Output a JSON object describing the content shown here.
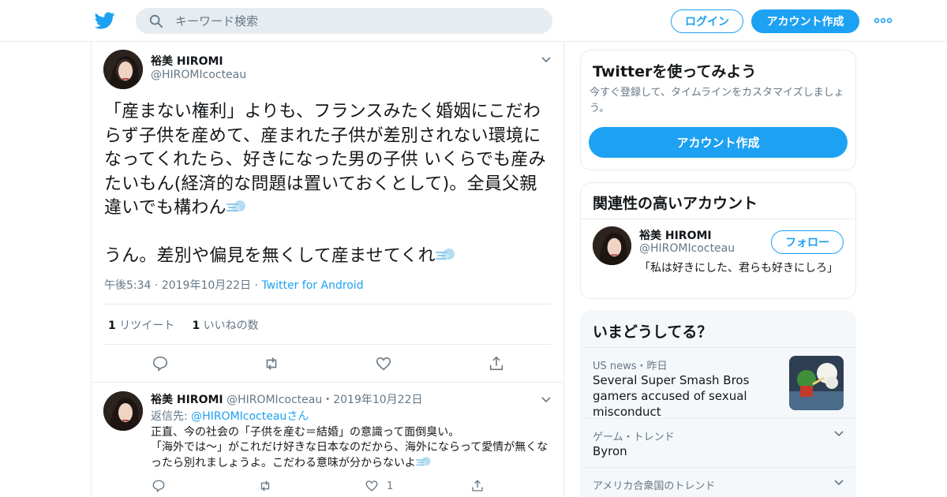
{
  "header": {
    "search_placeholder": "キーワード検索",
    "login_label": "ログイン",
    "signup_label": "アカウント作成"
  },
  "tweet": {
    "author_name": "裕美 HIROMI",
    "author_handle": "@HIROMIcocteau",
    "text_1": "「産まない権利」よりも、フランスみたく婚姻にこだわらず子供を産めて、産まれた子供が差別されない環境になってくれたら、好きになった男の子供 いくらでも産みたいもん(経済的な問題は置いておくとして)。全員父親違いでも構わん",
    "text_2": "うん。差別や偏見を無くして産ませてくれ",
    "time": "午後5:34",
    "date": "2019年10月22日",
    "source": "Twitter for Android",
    "retweet_count": "1",
    "retweet_label": "リツイート",
    "like_count": "1",
    "like_label": "いいねの数"
  },
  "reply": {
    "author_name": "裕美 HIROMI",
    "author_handle": "@HIROMIcocteau",
    "date": "2019年10月22日",
    "reply_to_label": "返信先:",
    "reply_to_handle": "@HIROMIcocteau",
    "reply_to_suffix": "さん",
    "text": "正直、今の社会の「子供を産む＝結婚」の意識って面倒臭い。\n「海外では～」がこれだけ好きな日本なのだから、海外にならって愛情が無くなったら別れましょうよ。こだわる意味が分からないよ",
    "like_count": "1"
  },
  "sidebar": {
    "signup_card": {
      "title": "Twitterを使ってみよう",
      "subtitle": "今すぐ登録して、タイムラインをカスタマイズしましょう。",
      "button": "アカウント作成"
    },
    "related": {
      "title": "関連性の高いアカウント",
      "name": "裕美 HIROMI",
      "handle": "@HIROMIcocteau",
      "follow_label": "フォロー",
      "bio": "「私は好きにした、君らも好きにしろ」"
    },
    "trends": {
      "title": "いまどうしてる？",
      "items": [
        {
          "context": "US news・昨日",
          "title": "Several Super Smash Bros gamers accused of sexual misconduct"
        },
        {
          "context": "ゲーム・トレンド",
          "title": "Byron"
        },
        {
          "context": "アメリカ合衆国のトレンド",
          "title": ""
        }
      ]
    }
  },
  "colors": {
    "accent": "#1da1f2",
    "secondary_text": "#657786",
    "border": "#e6ecf0"
  }
}
